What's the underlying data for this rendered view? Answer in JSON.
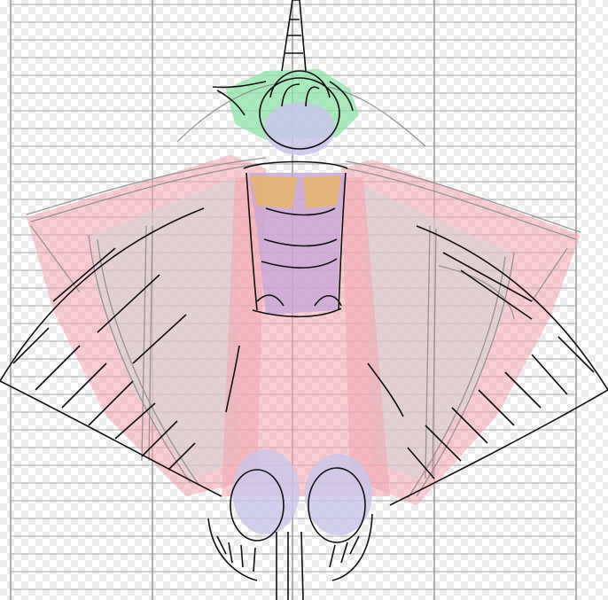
{
  "canvas": {
    "description_visible_text": "",
    "colors": {
      "grid": "#9a9a9a",
      "wing_fill": "#f3a6b0",
      "membrane_fill": "#d9d9d9",
      "hair": "#8fe3a8",
      "head": "#c9c6ea",
      "torso": "#c7a6d6",
      "chest": "#e6b56b",
      "feet": "#c9c6ea",
      "sketch_gray": "#8a8a8a",
      "sketch_black": "#111111"
    }
  }
}
